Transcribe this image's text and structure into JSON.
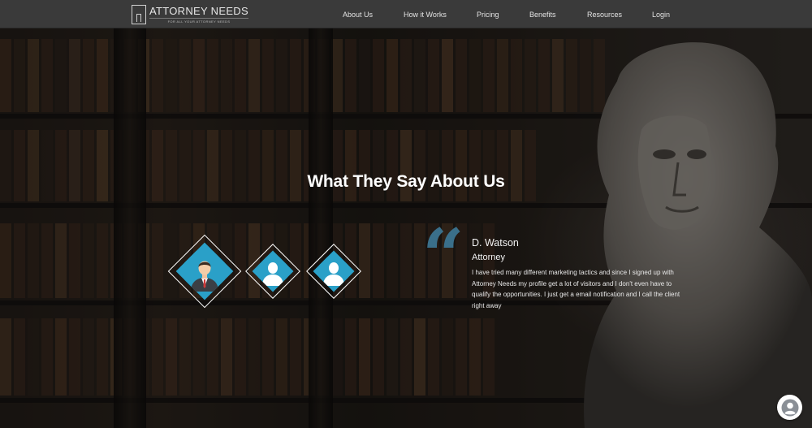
{
  "logo": {
    "title": "ATTORNEY NEEDS",
    "tagline": "FOR ALL YOUR ATTORNEY NEEDS"
  },
  "nav": {
    "items": [
      {
        "label": "About Us"
      },
      {
        "label": "How it Works"
      },
      {
        "label": "Pricing"
      },
      {
        "label": "Benefits"
      },
      {
        "label": "Resources"
      },
      {
        "label": "Login"
      }
    ]
  },
  "testimonials": {
    "heading": "What They Say About Us",
    "active": {
      "name": "D. Watson",
      "role": "Attorney",
      "quote": "I have tried many different marketing tactics and since I signed up with Attorney Needs my profile get a lot of visitors and I don't even have to qualify the opportunities. I just get a email notification and I call the client right away"
    },
    "quote_mark": "“"
  },
  "colors": {
    "accent": "#2aa0c8",
    "quote_mark": "#3a6f8a",
    "navbar": "#3a3a3a"
  },
  "icons": {
    "chat": "user-chat-icon",
    "avatar": "person-avatar-icon"
  }
}
